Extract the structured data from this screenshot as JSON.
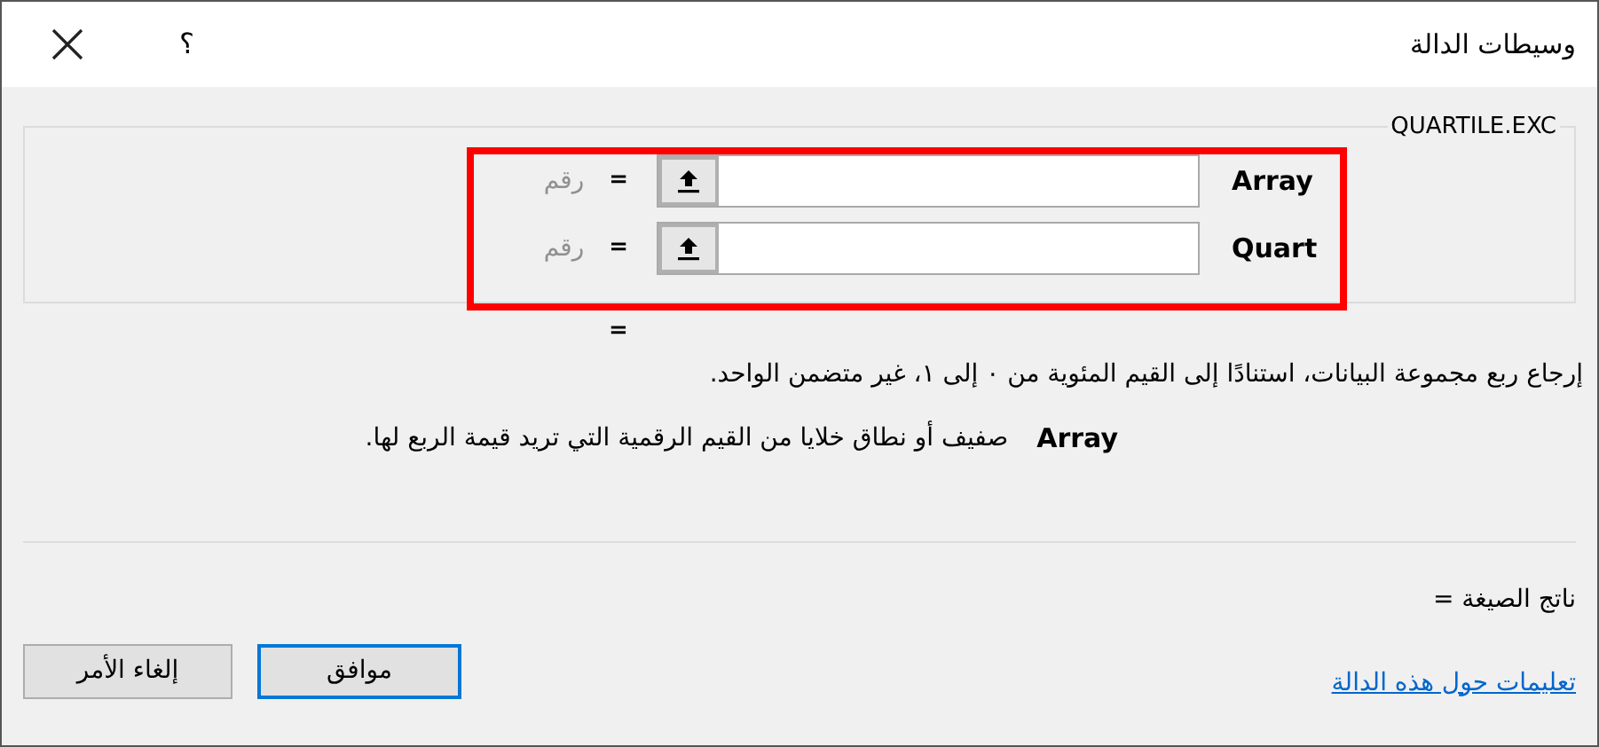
{
  "window": {
    "title": "وسيطات الدالة",
    "help": "؟"
  },
  "function": {
    "name": "QUARTILE.EXC",
    "arguments_highlighted": true,
    "arguments": [
      {
        "label": "Array",
        "equals": "=",
        "hint": "رقم"
      },
      {
        "label": "Quart",
        "equals": "=",
        "hint": "رقم"
      }
    ],
    "result_equals": "=",
    "description": "إرجاع ربع مجموعة البيانات، استنادًا إلى القيم المئوية من ٠ إلى ١، غير متضمن الواحد.",
    "argument_help": {
      "name": "Array",
      "text": "صفيف أو نطاق خلايا من القيم الرقمية التي تريد قيمة الربع لها."
    }
  },
  "formula_result": "ناتج الصيغة =",
  "link": "تعليمات حول هذه الدالة",
  "buttons": [
    {
      "label": "موافق",
      "default": true
    },
    {
      "label": "إلغاء الأمر",
      "default": false
    }
  ]
}
